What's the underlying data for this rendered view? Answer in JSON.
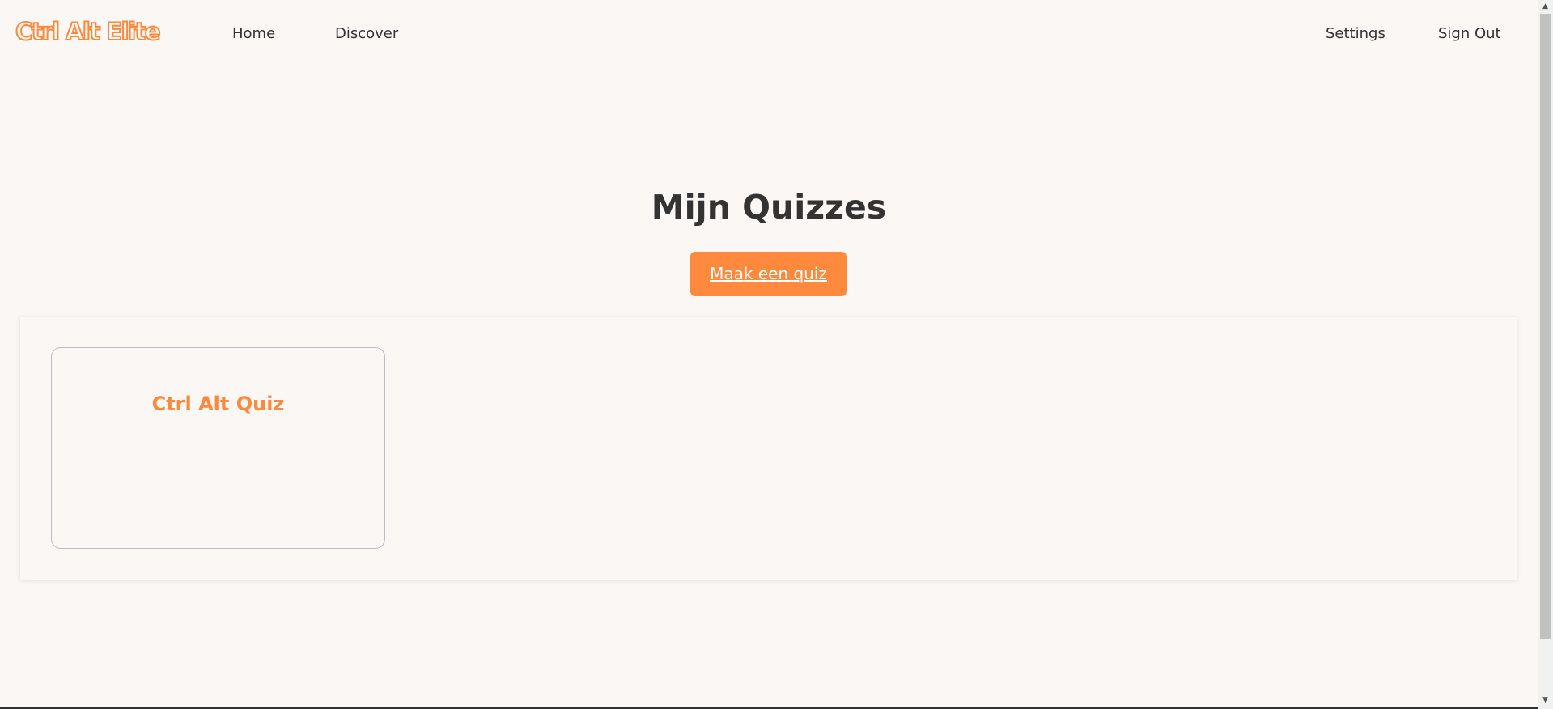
{
  "nav": {
    "logo": "Ctrl Alt Elite",
    "home": "Home",
    "discover": "Discover",
    "settings": "Settings",
    "sign_out": "Sign Out"
  },
  "main": {
    "title": "Mijn Quizzes",
    "create_button": "Maak een quiz"
  },
  "quizzes": [
    {
      "title": "Ctrl Alt Quiz"
    }
  ],
  "colors": {
    "accent": "#ff8a3d",
    "background": "#fbf7f4",
    "text": "#333333"
  },
  "scrollbar": {
    "up_icon": "▲",
    "down_icon": "▼"
  }
}
